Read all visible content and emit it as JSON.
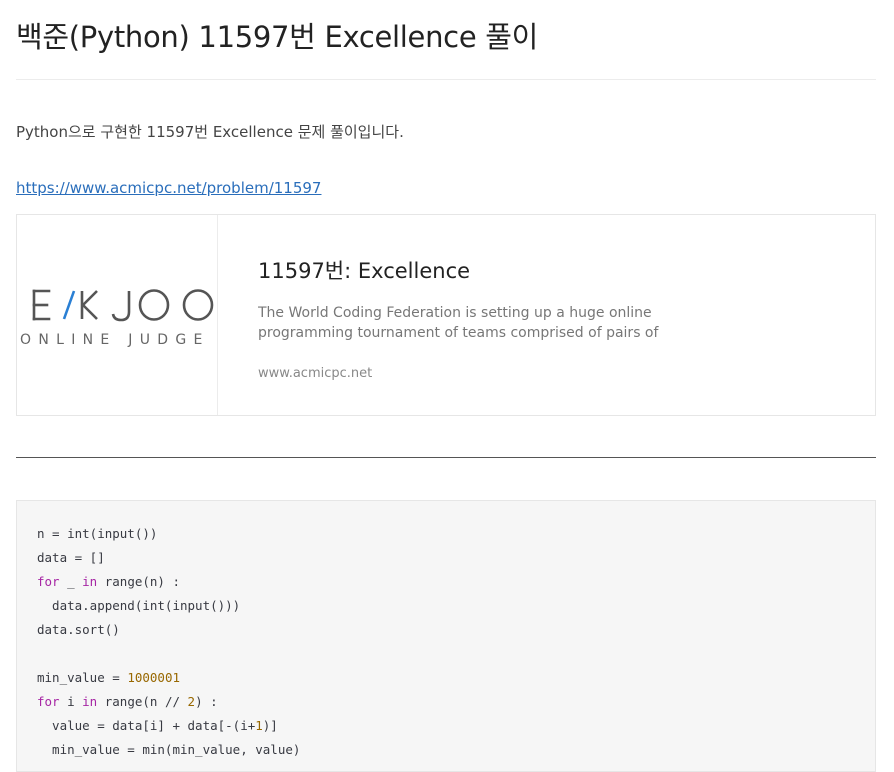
{
  "post": {
    "title": "백준(Python) 11597번 Excellence 풀이",
    "intro": "Python으로 구현한 11597번 Excellence 문제 풀이입니다.",
    "source_url": "https://www.acmicpc.net/problem/11597"
  },
  "link_card": {
    "logo_main": "E/KJOO",
    "logo_sub": "ONLINE JUDGE",
    "title": "11597번: Excellence",
    "description": "The World Coding Federation is setting up a huge online programming tournament of teams comprised of pairs of programmers. Judge Dav…",
    "domain": "www.acmicpc.net"
  },
  "colors": {
    "link": "#2a6ebb",
    "keyword": "#a626a4",
    "number": "#986801",
    "logo_accent": "#2a7fd4"
  },
  "code": {
    "language": "python",
    "lines": [
      [
        {
          "t": "n = int(input())",
          "k": "plain"
        }
      ],
      [
        {
          "t": "data = []",
          "k": "plain"
        }
      ],
      [
        {
          "t": "for",
          "k": "kw"
        },
        {
          "t": " _ ",
          "k": "plain"
        },
        {
          "t": "in",
          "k": "kw"
        },
        {
          "t": " range(n) :",
          "k": "plain"
        }
      ],
      [
        {
          "t": "  data.append(int(input()))",
          "k": "plain"
        }
      ],
      [
        {
          "t": "data.sort()",
          "k": "plain"
        }
      ],
      [
        {
          "t": "",
          "k": "plain"
        }
      ],
      [
        {
          "t": "min_value = ",
          "k": "plain"
        },
        {
          "t": "1000001",
          "k": "num"
        }
      ],
      [
        {
          "t": "for",
          "k": "kw"
        },
        {
          "t": " i ",
          "k": "plain"
        },
        {
          "t": "in",
          "k": "kw"
        },
        {
          "t": " range(n // ",
          "k": "plain"
        },
        {
          "t": "2",
          "k": "num"
        },
        {
          "t": ") :",
          "k": "plain"
        }
      ],
      [
        {
          "t": "  value = data[i] + data[-(i+",
          "k": "plain"
        },
        {
          "t": "1",
          "k": "num"
        },
        {
          "t": ")]",
          "k": "plain"
        }
      ],
      [
        {
          "t": "  min_value = min(min_value, value)",
          "k": "plain"
        }
      ]
    ]
  }
}
